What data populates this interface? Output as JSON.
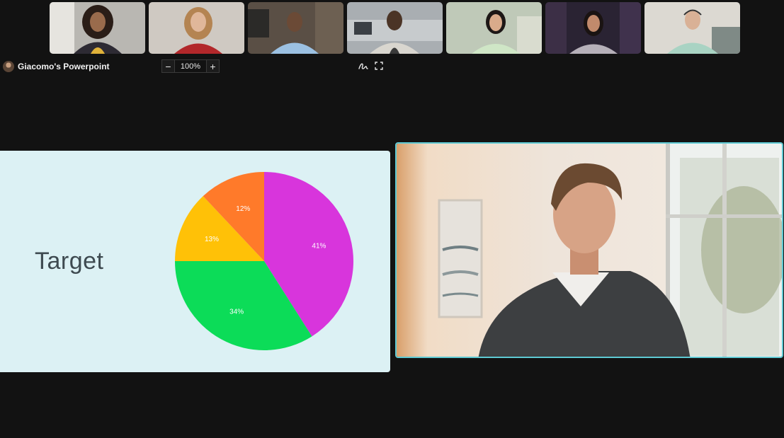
{
  "presenter": {
    "name": "Giacomo's Powerpoint"
  },
  "zoom": {
    "decrease_label": "−",
    "value": "100%",
    "increase_label": "+"
  },
  "tools": {
    "annotate_icon": "pen-scribble-icon",
    "fullscreen_icon": "expand-icon"
  },
  "slide": {
    "title": "Target"
  },
  "chart_data": {
    "type": "pie",
    "slices": [
      {
        "label": "41%",
        "value": 41,
        "color": "#d835dc"
      },
      {
        "label": "34%",
        "value": 34,
        "color": "#0cdc58"
      },
      {
        "label": "13%",
        "value": 13,
        "color": "#ffc107"
      },
      {
        "label": "12%",
        "value": 12,
        "color": "#ff7a2a"
      }
    ]
  },
  "colors": {
    "background": "#121212",
    "slide_background": "#dcf1f4",
    "active_speaker_border": "#5ec9d3"
  }
}
